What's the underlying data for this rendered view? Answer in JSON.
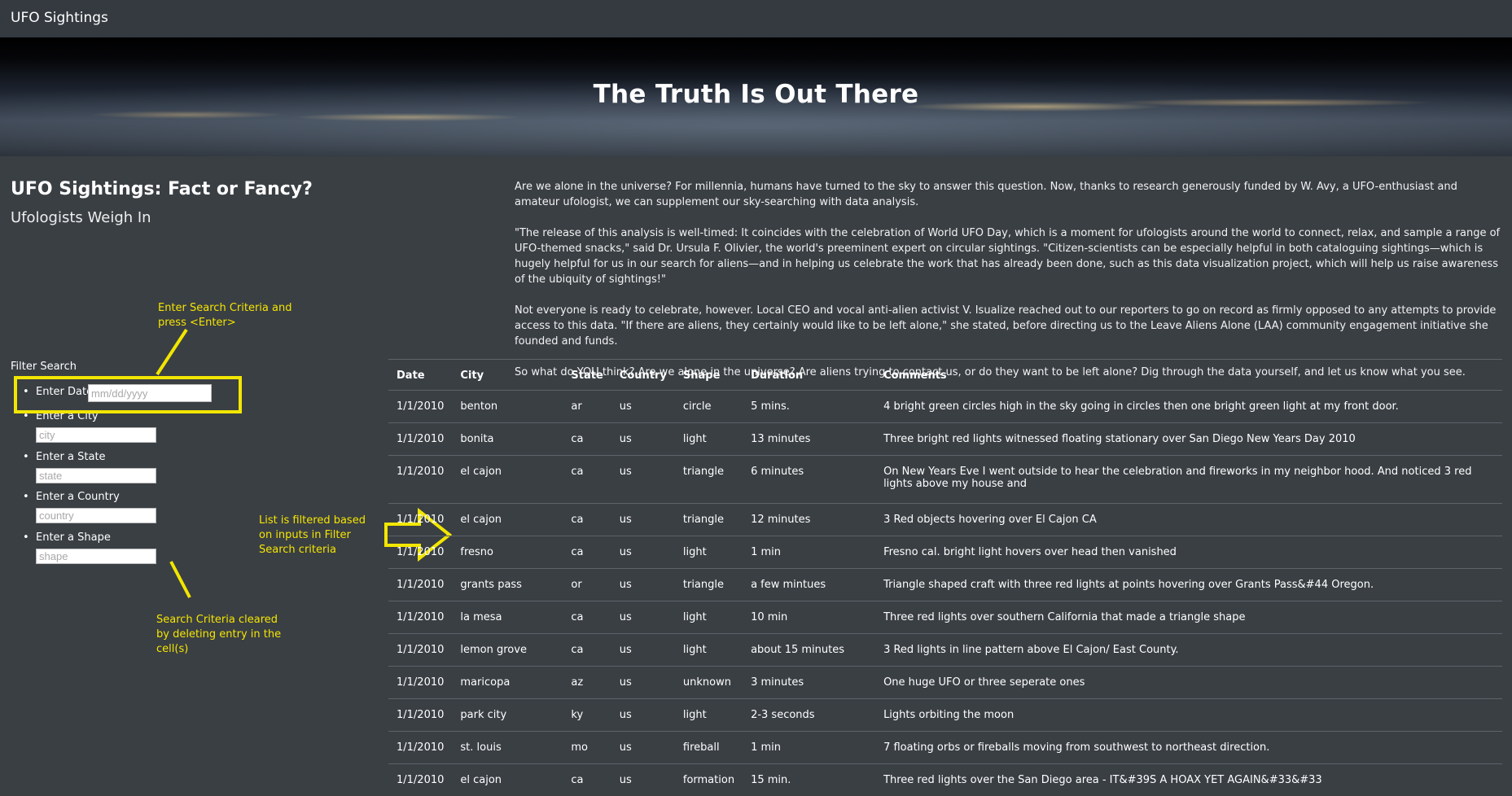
{
  "navbar": {
    "brand": "UFO Sightings"
  },
  "hero": {
    "title": "The Truth Is Out There"
  },
  "left": {
    "title": "UFO Sightings: Fact or Fancy?",
    "subtitle": "Ufologists Weigh In"
  },
  "intro": [
    "Are we alone in the universe? For millennia, humans have turned to the sky to answer this question. Now, thanks to research generously funded by W. Avy, a UFO-enthusiast and amateur ufologist, we can supplement our sky-searching with data analysis.",
    "\"The release of this analysis is well-timed: It coincides with the celebration of World UFO Day, which is a moment for ufologists around the world to connect, relax, and sample a range of UFO-themed snacks,\" said Dr. Ursula F. Olivier, the world's preeminent expert on circular sightings. \"Citizen-scientists can be especially helpful in both cataloguing sightings—which is hugely helpful for us in our search for aliens—and in helping us celebrate the work that has already been done, such as this data visualization project, which will help us raise awareness of the ubiquity of sightings!\"",
    "Not everyone is ready to celebrate, however. Local CEO and vocal anti-alien activist V. Isualize reached out to our reporters to go on record as firmly opposed to any attempts to provide access to this data. \"If there are aliens, they certainly would like to be left alone,\" she stated, before directing us to the Leave Aliens Alone (LAA) community engagement initiative she founded and funds.",
    "So what do YOU think? Are we alone in the universe? Are aliens trying to contact us, or do they want to be left alone? Dig through the data yourself, and let us know what you see."
  ],
  "filters": {
    "title": "Filter Search",
    "date": {
      "label": "Enter Date",
      "placeholder": "mm/dd/yyyy",
      "value": ""
    },
    "city": {
      "label": "Enter a City",
      "placeholder": "city",
      "value": ""
    },
    "state": {
      "label": "Enter a State",
      "placeholder": "state",
      "value": ""
    },
    "country": {
      "label": "Enter a Country",
      "placeholder": "country",
      "value": ""
    },
    "shape": {
      "label": "Enter a Shape",
      "placeholder": "shape",
      "value": ""
    }
  },
  "annotations": {
    "enter_criteria": "Enter Search Criteria and press <Enter>",
    "list_filtered": "List is filtered based on inputs in Filter Search criteria",
    "criteria_cleared": "Search Criteria cleared by deleting entry in the cell(s)",
    "color": "#f5e500"
  },
  "table": {
    "headers": [
      "Date",
      "City",
      "State",
      "Country",
      "Shape",
      "Duration",
      "Comments"
    ],
    "rows": [
      [
        "1/1/2010",
        "benton",
        "ar",
        "us",
        "circle",
        "5 mins.",
        "4 bright green circles high in the sky going in circles then one bright green light at my front door."
      ],
      [
        "1/1/2010",
        "bonita",
        "ca",
        "us",
        "light",
        "13 minutes",
        "Three bright red lights witnessed floating stationary over San Diego New Years Day 2010"
      ],
      [
        "1/1/2010",
        "el cajon",
        "ca",
        "us",
        "triangle",
        "6 minutes",
        "On New Years Eve I went outside to hear the celebration and fireworks in my neighbor hood. And noticed 3 red lights above my house and"
      ],
      [
        "1/1/2010",
        "el cajon",
        "ca",
        "us",
        "triangle",
        "12 minutes",
        "3 Red objects hovering over El Cajon CA"
      ],
      [
        "1/1/2010",
        "fresno",
        "ca",
        "us",
        "light",
        "1 min",
        "Fresno cal. bright light hovers over head then vanished"
      ],
      [
        "1/1/2010",
        "grants pass",
        "or",
        "us",
        "triangle",
        "a few mintues",
        "Triangle shaped craft with three red lights at points hovering over Grants Pass&#44 Oregon."
      ],
      [
        "1/1/2010",
        "la mesa",
        "ca",
        "us",
        "light",
        "10 min",
        "Three red lights over southern California that made a triangle shape"
      ],
      [
        "1/1/2010",
        "lemon grove",
        "ca",
        "us",
        "light",
        "about 15 minutes",
        "3 Red lights in line pattern above El Cajon/ East County."
      ],
      [
        "1/1/2010",
        "maricopa",
        "az",
        "us",
        "unknown",
        "3 minutes",
        "One huge UFO or three seperate ones"
      ],
      [
        "1/1/2010",
        "park city",
        "ky",
        "us",
        "light",
        "2-3 seconds",
        "Lights orbiting the moon"
      ],
      [
        "1/1/2010",
        "st. louis",
        "mo",
        "us",
        "fireball",
        "1 min",
        "7 floating orbs or fireballs moving from southwest to northeast direction."
      ],
      [
        "1/1/2010",
        "el cajon",
        "ca",
        "us",
        "formation",
        "15 min.",
        "Three red lights over the San Diego area - IT&#39S A HOAX YET AGAIN&#33&#33"
      ]
    ]
  }
}
